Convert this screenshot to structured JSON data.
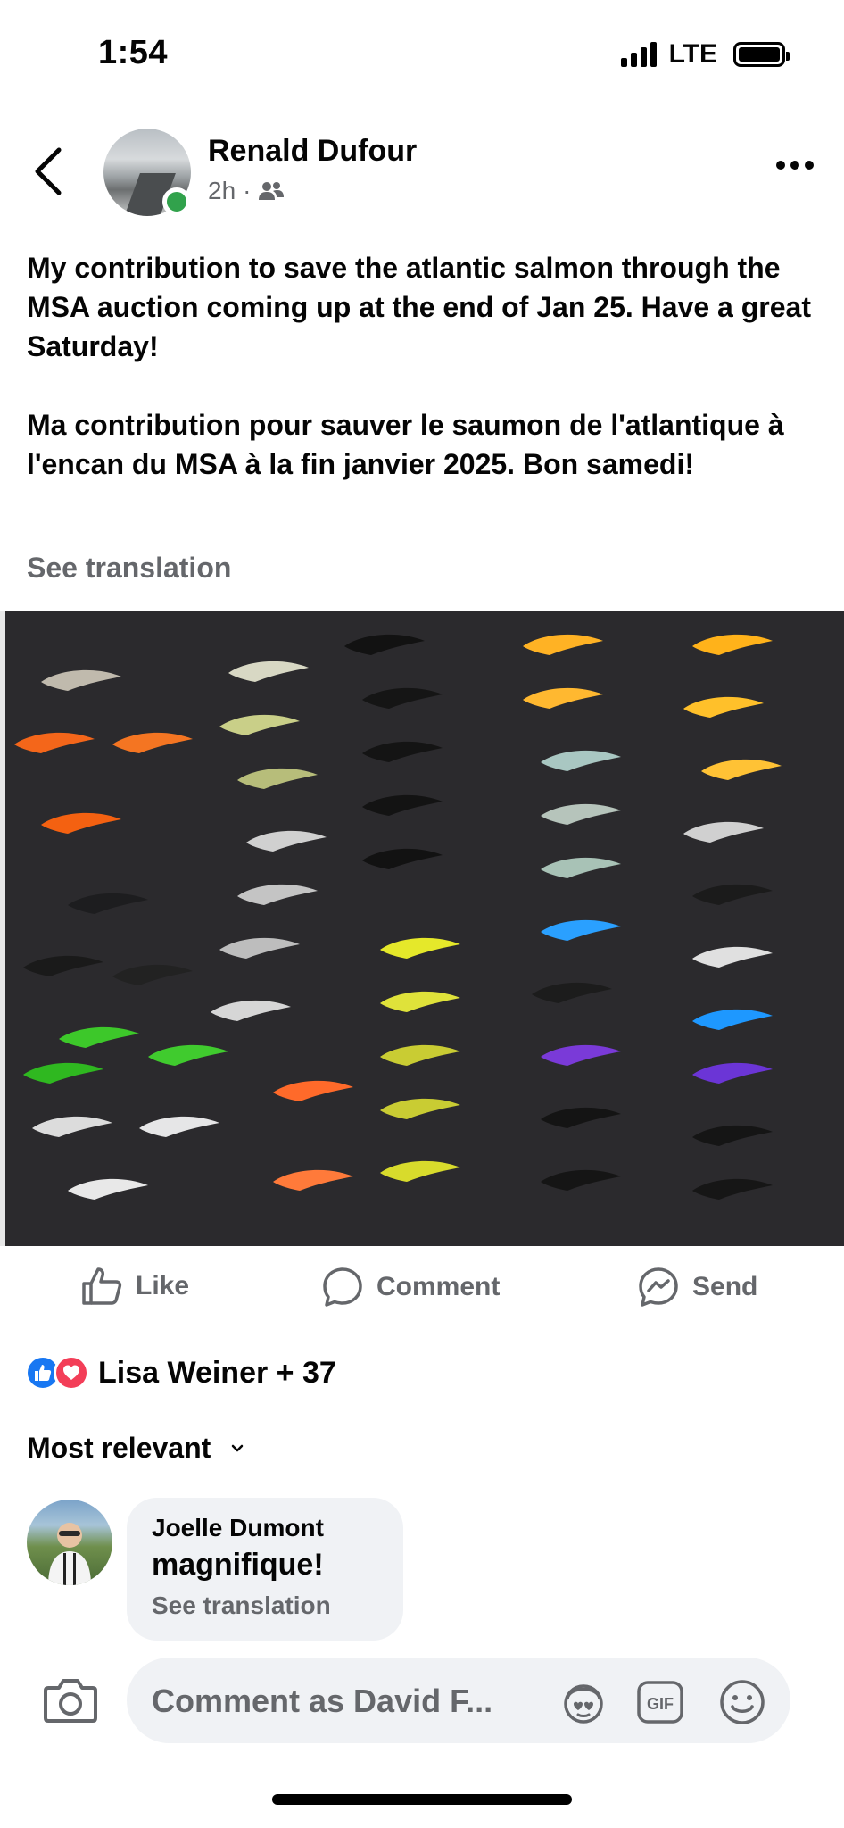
{
  "status_bar": {
    "time": "1:54",
    "network": "LTE"
  },
  "post": {
    "author": "Renald Dufour",
    "time_ago": "2h",
    "audience_icon": "friends-icon",
    "text": "My contribution to save the atlantic salmon through the MSA auction coming up at the end of Jan 25.  Have a  great Saturday!\n\nMa contribution pour sauver le saumon de l'atlantique à l'encan du MSA à la fin janvier 2025. Bon samedi!",
    "see_translation": "See translation"
  },
  "actions": {
    "like": "Like",
    "comment": "Comment",
    "send": "Send"
  },
  "reactions": {
    "summary": "Lisa Weiner + 37"
  },
  "comments_sort": {
    "label": "Most relevant"
  },
  "comment": {
    "author": "Joelle Dumont",
    "text": "magnifique!",
    "see_translation": "See translation"
  },
  "composer": {
    "placeholder": "Comment as David F..."
  },
  "colors": {
    "accent": "#1877f2",
    "love": "#f33e58",
    "online": "#31a24c",
    "secondary_text": "#65676b"
  }
}
